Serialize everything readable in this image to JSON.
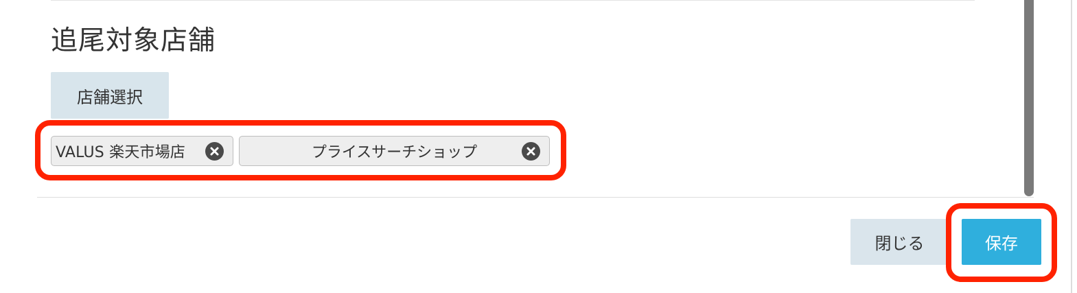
{
  "section": {
    "title": "追尾対象店舗"
  },
  "store_select": {
    "label": "店舗選択"
  },
  "selected_stores": [
    {
      "label": "VALUS  楽天市場店"
    },
    {
      "label": "プライスサーチショップ"
    }
  ],
  "footer": {
    "close_label": "閉じる",
    "save_label": "保存"
  },
  "colors": {
    "highlight": "#ff2200",
    "save_button": "#2fafdd",
    "secondary_button": "#dae5ec",
    "tag_background": "#eeeeee"
  },
  "icons": {
    "tag_remove": "close-circle-icon"
  }
}
